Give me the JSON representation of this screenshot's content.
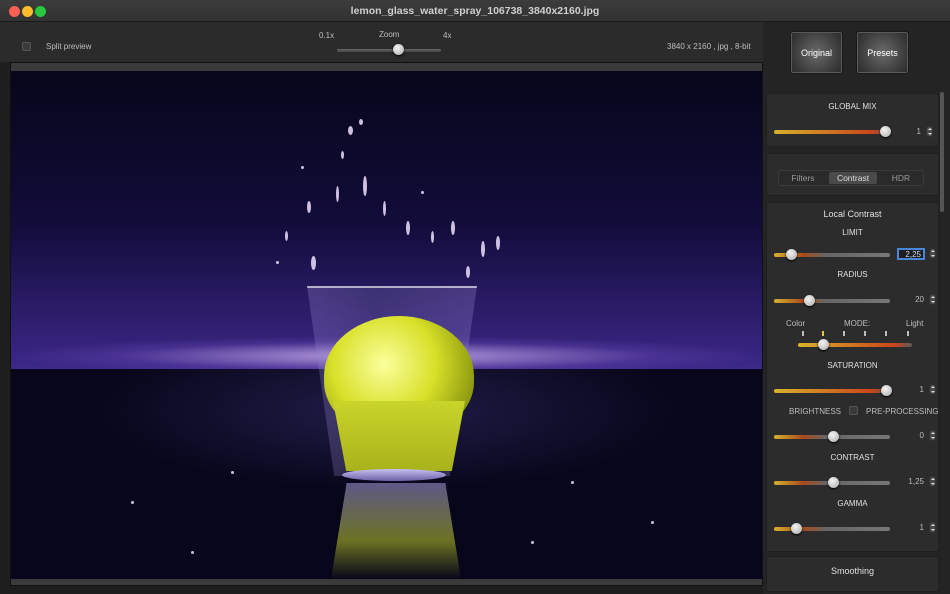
{
  "window": {
    "title": "lemon_glass_water_spray_106738_3840x2160.jpg"
  },
  "toolbar": {
    "split_preview_label": "Split preview",
    "zoom_label": "Zoom",
    "zoom_min": "0.1x",
    "zoom_max": "4x",
    "image_info": "3840 x 2160 , jpg , 8-bit"
  },
  "top_buttons": {
    "original": "Original",
    "presets": "Presets"
  },
  "global_mix": {
    "label": "GLOBAL MIX",
    "value": "1"
  },
  "tabs": [
    "Filters",
    "Contrast",
    "HDR"
  ],
  "active_tab": "Contrast",
  "local_contrast": {
    "title": "Local Contrast",
    "limit": {
      "label": "LIMIT",
      "value": "2,25"
    },
    "radius": {
      "label": "RADIUS",
      "value": "20"
    },
    "mode": {
      "left": "Color",
      "center": "MODE:",
      "right": "Light"
    },
    "saturation": {
      "label": "SATURATION",
      "value": "1"
    },
    "brightness_label": "BRIGHTNESS",
    "preprocessing_label": "PRE-PROCESSING",
    "brightness_value": "0",
    "contrast": {
      "label": "CONTRAST",
      "value": "1,25"
    },
    "gamma": {
      "label": "GAMMA",
      "value": "1"
    }
  },
  "smoothing": {
    "title": "Smoothing"
  },
  "colors": {
    "accent_start": "#d8b22a",
    "accent_end": "#c9441b",
    "focus_ring": "#4a86d8"
  }
}
